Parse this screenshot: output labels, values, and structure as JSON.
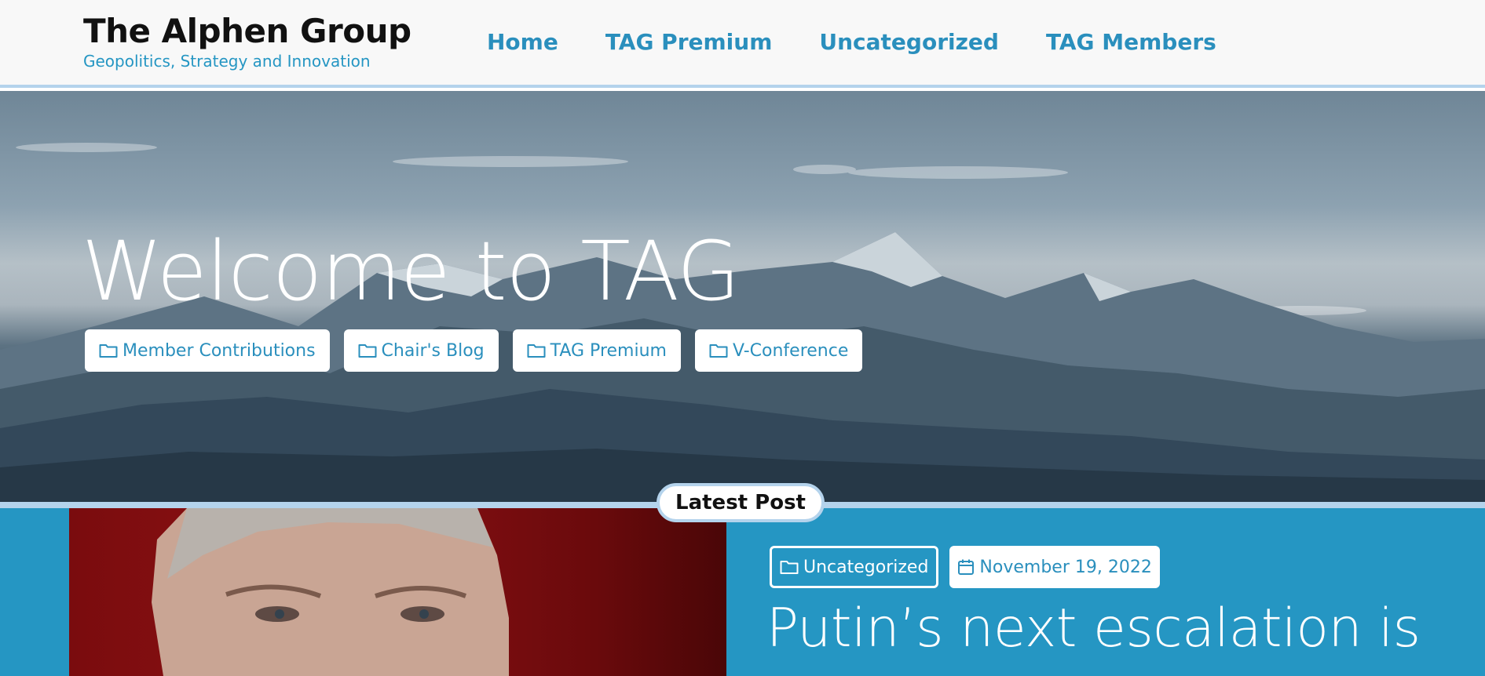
{
  "header": {
    "site_title": "The Alphen Group",
    "tagline": "Geopolitics, Strategy and Innovation",
    "nav": [
      {
        "label": "Home"
      },
      {
        "label": "TAG Premium"
      },
      {
        "label": "Uncategorized"
      },
      {
        "label": "TAG Members"
      }
    ]
  },
  "hero": {
    "title": "Welcome to TAG",
    "categories": [
      {
        "label": "Member Contributions",
        "icon": "folder-icon"
      },
      {
        "label": "Chair's Blog",
        "icon": "folder-icon"
      },
      {
        "label": "TAG Premium",
        "icon": "folder-icon"
      },
      {
        "label": "V-Conference",
        "icon": "folder-icon"
      }
    ]
  },
  "latest": {
    "badge": "Latest Post",
    "category": "Uncategorized",
    "date": "November 19, 2022",
    "title": "Putin’s next escalation is"
  },
  "colors": {
    "accent": "#2596c3",
    "link": "#2a8fbd",
    "divider": "#b4d3ec"
  }
}
